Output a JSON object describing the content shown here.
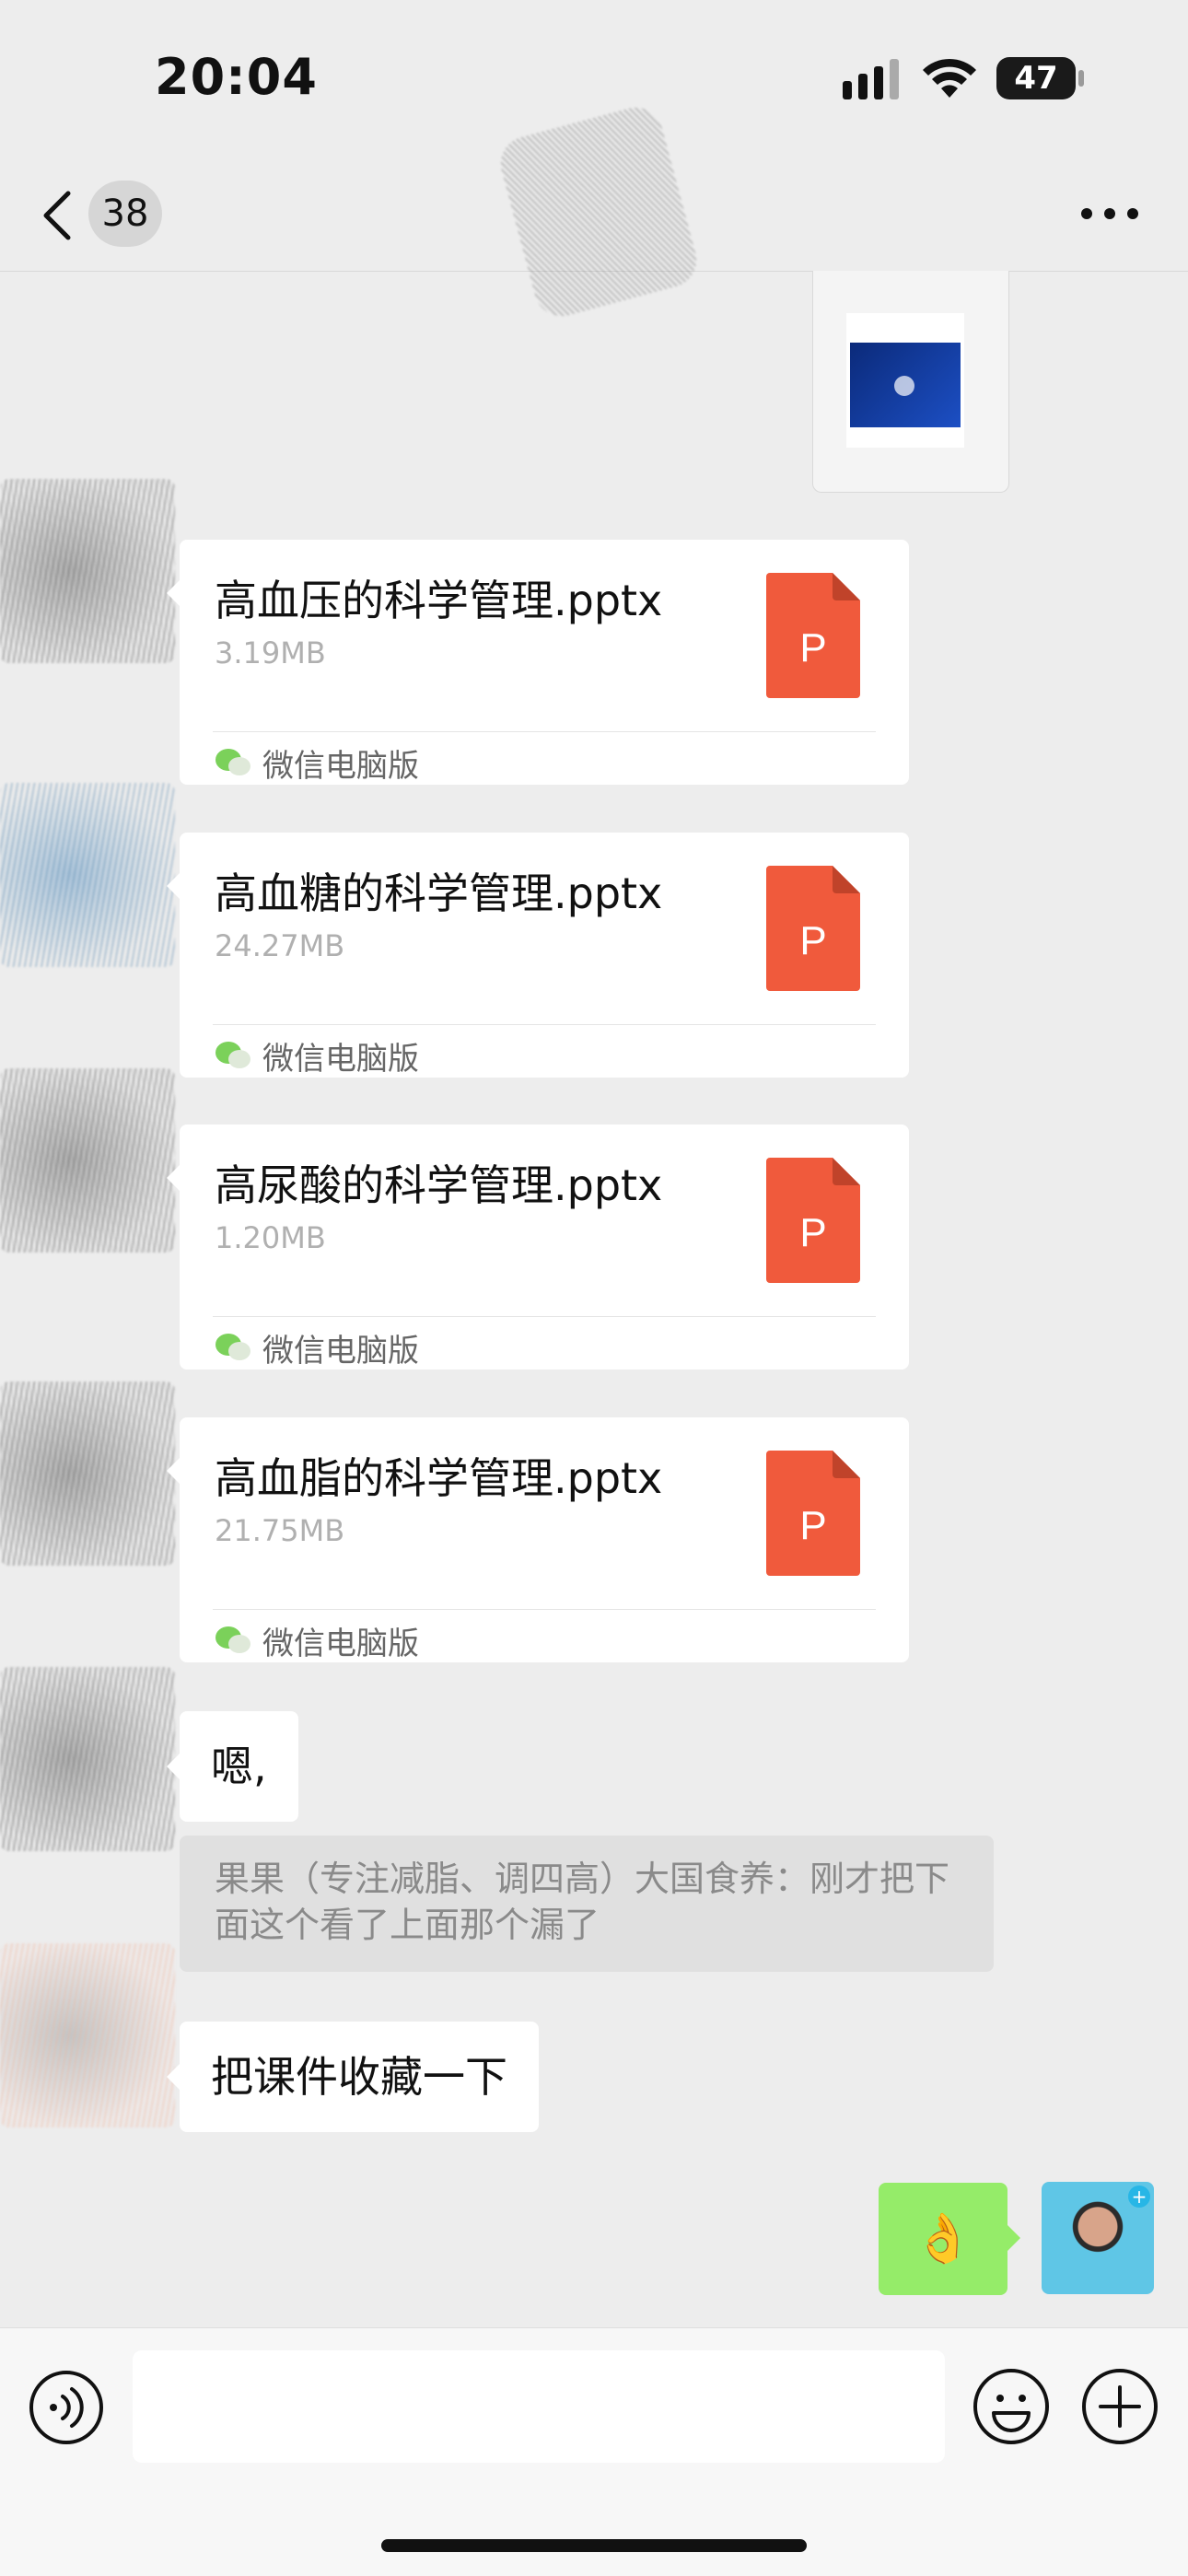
{
  "status_bar": {
    "time": "20:04",
    "battery": "47",
    "icons": [
      "signal-icon",
      "wifi-icon",
      "battery-icon"
    ]
  },
  "nav": {
    "back_icon": "chevron-left-icon",
    "unread_count": "38",
    "more_icon": "more-dots-icon"
  },
  "messages": {
    "files": [
      {
        "name": "高血压的科学管理.pptx",
        "size": "3.19MB",
        "source": "微信电脑版",
        "icon": "ppt-file-icon"
      },
      {
        "name": "高血糖的科学管理.pptx",
        "size": "24.27MB",
        "source": "微信电脑版",
        "icon": "ppt-file-icon"
      },
      {
        "name": "高尿酸的科学管理.pptx",
        "size": "1.20MB",
        "source": "微信电脑版",
        "icon": "ppt-file-icon"
      },
      {
        "name": "高血脂的科学管理.pptx",
        "size": "21.75MB",
        "source": "微信电脑版",
        "icon": "ppt-file-icon"
      }
    ],
    "ppt_letter": "P",
    "text_1": "嗯,",
    "quote": "果果（专注减脂、调四高）大国食养：刚才把下面这个看了上面那个漏了",
    "text_2": "把课件收藏一下",
    "sent": "👌",
    "my_avatar_badge": "+"
  },
  "input_bar": {
    "voice_icon": "voice-icon",
    "placeholder": "",
    "emoji_icon": "emoji-icon",
    "plus_icon": "plus-circle-icon"
  },
  "colors": {
    "background": "#ededed",
    "sent_bubble": "#95ec69",
    "ppt_icon": "#f05a3c",
    "file_size": "#b0b0b0",
    "quote_text": "#8a8a8a"
  }
}
